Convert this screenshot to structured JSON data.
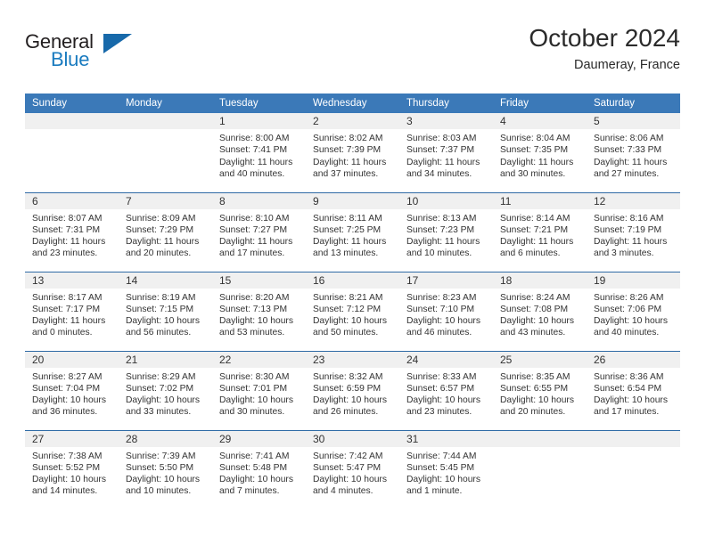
{
  "brand": {
    "name_part1": "General",
    "name_part2": "Blue",
    "accent_color": "#1769aa"
  },
  "header": {
    "title": "October 2024",
    "location": "Daumeray, France"
  },
  "calendar": {
    "header_bg": "#3b79b8",
    "daynum_bg": "#f0f0f0",
    "separator_color": "#2e6aa5",
    "weekday_headers": [
      "Sunday",
      "Monday",
      "Tuesday",
      "Wednesday",
      "Thursday",
      "Friday",
      "Saturday"
    ],
    "weeks": [
      [
        {
          "day": "",
          "sunrise": "",
          "sunset": "",
          "daylight": "",
          "empty": true
        },
        {
          "day": "",
          "sunrise": "",
          "sunset": "",
          "daylight": "",
          "empty": true
        },
        {
          "day": "1",
          "sunrise": "Sunrise: 8:00 AM",
          "sunset": "Sunset: 7:41 PM",
          "daylight": "Daylight: 11 hours and 40 minutes."
        },
        {
          "day": "2",
          "sunrise": "Sunrise: 8:02 AM",
          "sunset": "Sunset: 7:39 PM",
          "daylight": "Daylight: 11 hours and 37 minutes."
        },
        {
          "day": "3",
          "sunrise": "Sunrise: 8:03 AM",
          "sunset": "Sunset: 7:37 PM",
          "daylight": "Daylight: 11 hours and 34 minutes."
        },
        {
          "day": "4",
          "sunrise": "Sunrise: 8:04 AM",
          "sunset": "Sunset: 7:35 PM",
          "daylight": "Daylight: 11 hours and 30 minutes."
        },
        {
          "day": "5",
          "sunrise": "Sunrise: 8:06 AM",
          "sunset": "Sunset: 7:33 PM",
          "daylight": "Daylight: 11 hours and 27 minutes."
        }
      ],
      [
        {
          "day": "6",
          "sunrise": "Sunrise: 8:07 AM",
          "sunset": "Sunset: 7:31 PM",
          "daylight": "Daylight: 11 hours and 23 minutes."
        },
        {
          "day": "7",
          "sunrise": "Sunrise: 8:09 AM",
          "sunset": "Sunset: 7:29 PM",
          "daylight": "Daylight: 11 hours and 20 minutes."
        },
        {
          "day": "8",
          "sunrise": "Sunrise: 8:10 AM",
          "sunset": "Sunset: 7:27 PM",
          "daylight": "Daylight: 11 hours and 17 minutes."
        },
        {
          "day": "9",
          "sunrise": "Sunrise: 8:11 AM",
          "sunset": "Sunset: 7:25 PM",
          "daylight": "Daylight: 11 hours and 13 minutes."
        },
        {
          "day": "10",
          "sunrise": "Sunrise: 8:13 AM",
          "sunset": "Sunset: 7:23 PM",
          "daylight": "Daylight: 11 hours and 10 minutes."
        },
        {
          "day": "11",
          "sunrise": "Sunrise: 8:14 AM",
          "sunset": "Sunset: 7:21 PM",
          "daylight": "Daylight: 11 hours and 6 minutes."
        },
        {
          "day": "12",
          "sunrise": "Sunrise: 8:16 AM",
          "sunset": "Sunset: 7:19 PM",
          "daylight": "Daylight: 11 hours and 3 minutes."
        }
      ],
      [
        {
          "day": "13",
          "sunrise": "Sunrise: 8:17 AM",
          "sunset": "Sunset: 7:17 PM",
          "daylight": "Daylight: 11 hours and 0 minutes."
        },
        {
          "day": "14",
          "sunrise": "Sunrise: 8:19 AM",
          "sunset": "Sunset: 7:15 PM",
          "daylight": "Daylight: 10 hours and 56 minutes."
        },
        {
          "day": "15",
          "sunrise": "Sunrise: 8:20 AM",
          "sunset": "Sunset: 7:13 PM",
          "daylight": "Daylight: 10 hours and 53 minutes."
        },
        {
          "day": "16",
          "sunrise": "Sunrise: 8:21 AM",
          "sunset": "Sunset: 7:12 PM",
          "daylight": "Daylight: 10 hours and 50 minutes."
        },
        {
          "day": "17",
          "sunrise": "Sunrise: 8:23 AM",
          "sunset": "Sunset: 7:10 PM",
          "daylight": "Daylight: 10 hours and 46 minutes."
        },
        {
          "day": "18",
          "sunrise": "Sunrise: 8:24 AM",
          "sunset": "Sunset: 7:08 PM",
          "daylight": "Daylight: 10 hours and 43 minutes."
        },
        {
          "day": "19",
          "sunrise": "Sunrise: 8:26 AM",
          "sunset": "Sunset: 7:06 PM",
          "daylight": "Daylight: 10 hours and 40 minutes."
        }
      ],
      [
        {
          "day": "20",
          "sunrise": "Sunrise: 8:27 AM",
          "sunset": "Sunset: 7:04 PM",
          "daylight": "Daylight: 10 hours and 36 minutes."
        },
        {
          "day": "21",
          "sunrise": "Sunrise: 8:29 AM",
          "sunset": "Sunset: 7:02 PM",
          "daylight": "Daylight: 10 hours and 33 minutes."
        },
        {
          "day": "22",
          "sunrise": "Sunrise: 8:30 AM",
          "sunset": "Sunset: 7:01 PM",
          "daylight": "Daylight: 10 hours and 30 minutes."
        },
        {
          "day": "23",
          "sunrise": "Sunrise: 8:32 AM",
          "sunset": "Sunset: 6:59 PM",
          "daylight": "Daylight: 10 hours and 26 minutes."
        },
        {
          "day": "24",
          "sunrise": "Sunrise: 8:33 AM",
          "sunset": "Sunset: 6:57 PM",
          "daylight": "Daylight: 10 hours and 23 minutes."
        },
        {
          "day": "25",
          "sunrise": "Sunrise: 8:35 AM",
          "sunset": "Sunset: 6:55 PM",
          "daylight": "Daylight: 10 hours and 20 minutes."
        },
        {
          "day": "26",
          "sunrise": "Sunrise: 8:36 AM",
          "sunset": "Sunset: 6:54 PM",
          "daylight": "Daylight: 10 hours and 17 minutes."
        }
      ],
      [
        {
          "day": "27",
          "sunrise": "Sunrise: 7:38 AM",
          "sunset": "Sunset: 5:52 PM",
          "daylight": "Daylight: 10 hours and 14 minutes."
        },
        {
          "day": "28",
          "sunrise": "Sunrise: 7:39 AM",
          "sunset": "Sunset: 5:50 PM",
          "daylight": "Daylight: 10 hours and 10 minutes."
        },
        {
          "day": "29",
          "sunrise": "Sunrise: 7:41 AM",
          "sunset": "Sunset: 5:48 PM",
          "daylight": "Daylight: 10 hours and 7 minutes."
        },
        {
          "day": "30",
          "sunrise": "Sunrise: 7:42 AM",
          "sunset": "Sunset: 5:47 PM",
          "daylight": "Daylight: 10 hours and 4 minutes."
        },
        {
          "day": "31",
          "sunrise": "Sunrise: 7:44 AM",
          "sunset": "Sunset: 5:45 PM",
          "daylight": "Daylight: 10 hours and 1 minute."
        },
        {
          "day": "",
          "sunrise": "",
          "sunset": "",
          "daylight": "",
          "empty": true
        },
        {
          "day": "",
          "sunrise": "",
          "sunset": "",
          "daylight": "",
          "empty": true
        }
      ]
    ]
  }
}
